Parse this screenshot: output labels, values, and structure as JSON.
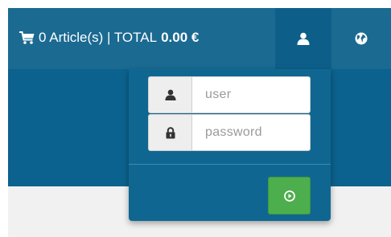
{
  "cart": {
    "icon": "shopping-cart-icon",
    "summary": "0 Article(s) | TOTAL",
    "total": "0.00 €"
  },
  "nav": {
    "user_icon": "user-icon",
    "globe_icon": "globe-icon"
  },
  "login": {
    "username": {
      "icon": "user-icon",
      "value": "",
      "placeholder": "user"
    },
    "password": {
      "icon": "lock-icon",
      "value": "",
      "placeholder": "password"
    },
    "submit_icon": "play-circle-icon"
  },
  "colors": {
    "header": "#1b6a92",
    "active_tab": "#0d5f8a",
    "panel": "#0f6791",
    "submit": "#4cae4c"
  }
}
